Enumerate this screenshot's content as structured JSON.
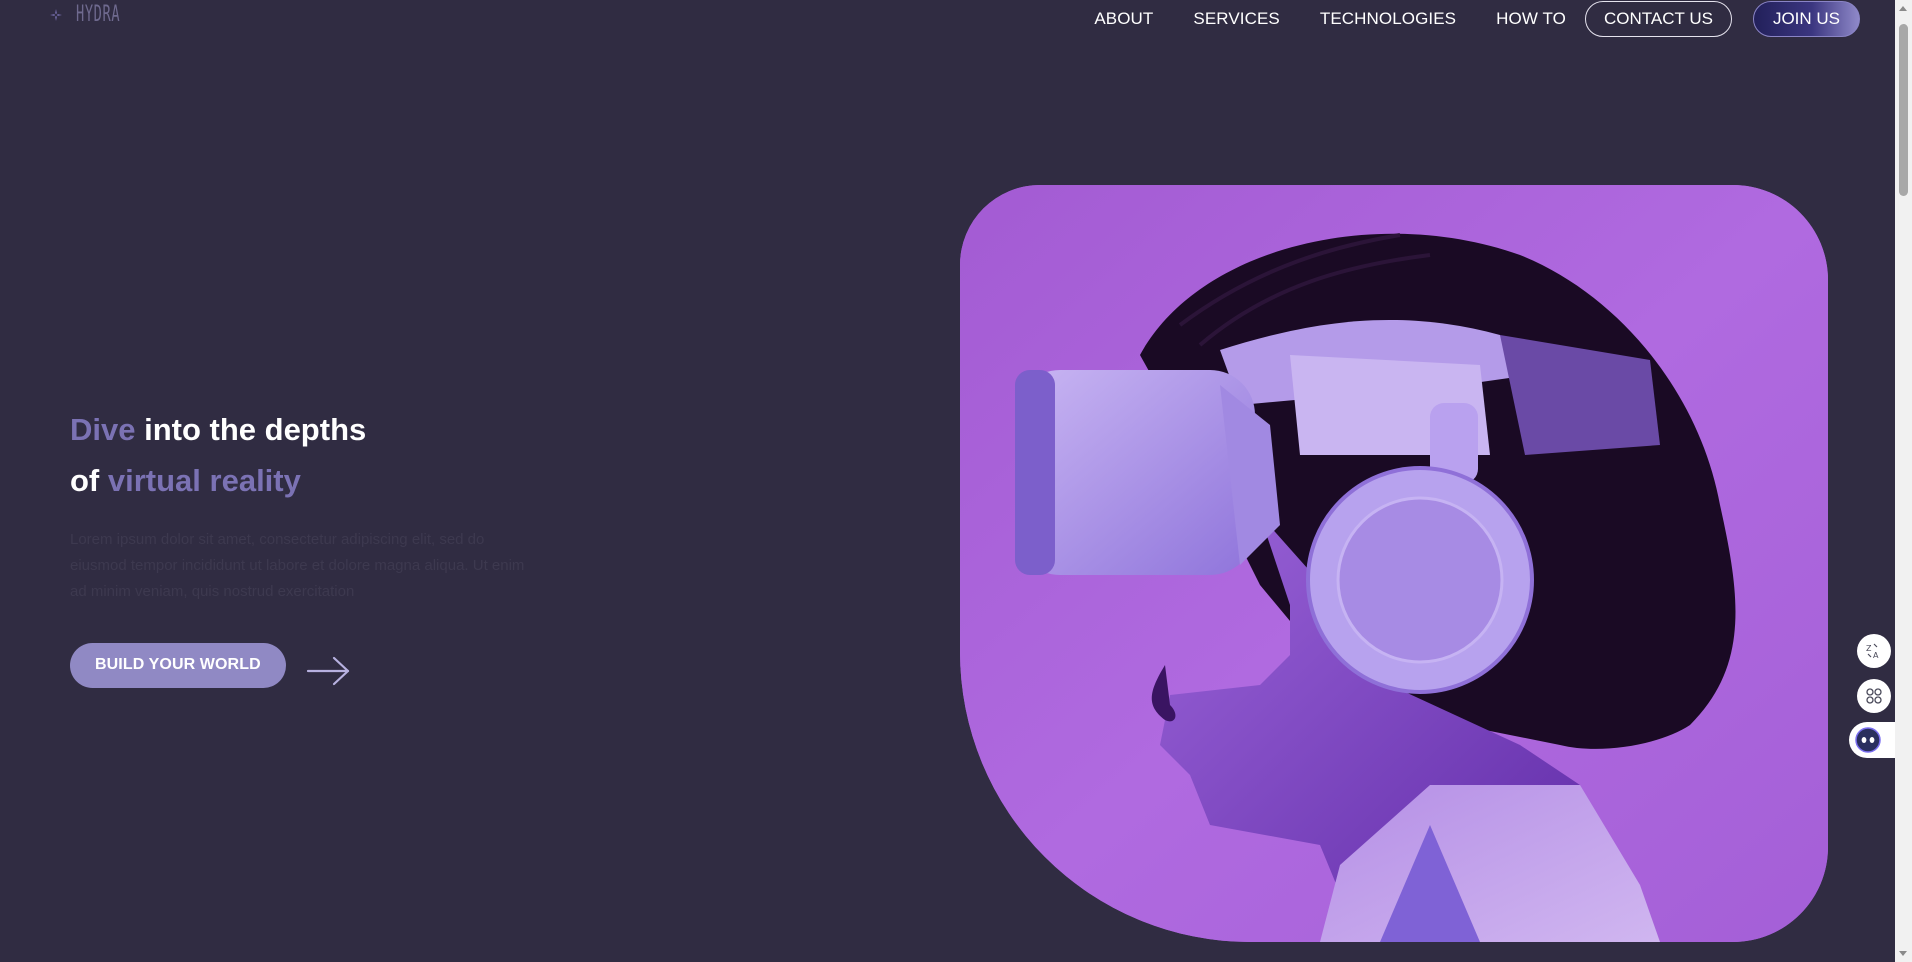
{
  "brand": {
    "logo_icon": "crosshair-star-icon",
    "name": "HYDRA"
  },
  "nav": {
    "items": [
      {
        "label": "ABOUT"
      },
      {
        "label": "SERVICES"
      },
      {
        "label": "TECHNOLOGIES"
      },
      {
        "label": "HOW TO"
      }
    ],
    "contact_label": "CONTACT US",
    "join_label": "JOIN US"
  },
  "hero": {
    "headline_line1_accent": "Dive",
    "headline_line1_rest": " into the depths",
    "headline_line2_prefix": "of ",
    "headline_line2_accent": "virtual reality",
    "description": "Lorem ipsum dolor sit amet, consectetur adipiscing elit, sed do eiusmod tempor incididunt ut labore et dolore magna aliqua. Ut enim ad minim veniam, quis nostrud exercitation",
    "cta_label": "BUILD YOUR WORLD",
    "cta_arrow_icon": "arrow-right-icon",
    "image_subject": "person-wearing-vr-headset-purple-light"
  },
  "side_tools": {
    "translate_icon": "translate-icon",
    "apps_icon": "apps-grid-icon",
    "assistant_icon": "assistant-bot-icon"
  },
  "colors": {
    "background": "#302c42",
    "accent": "#7b72b4",
    "cta": "#9089c4",
    "image_bg": "#a765d6",
    "join_gradient_start": "#22205a",
    "join_gradient_end": "#8f89c9"
  }
}
